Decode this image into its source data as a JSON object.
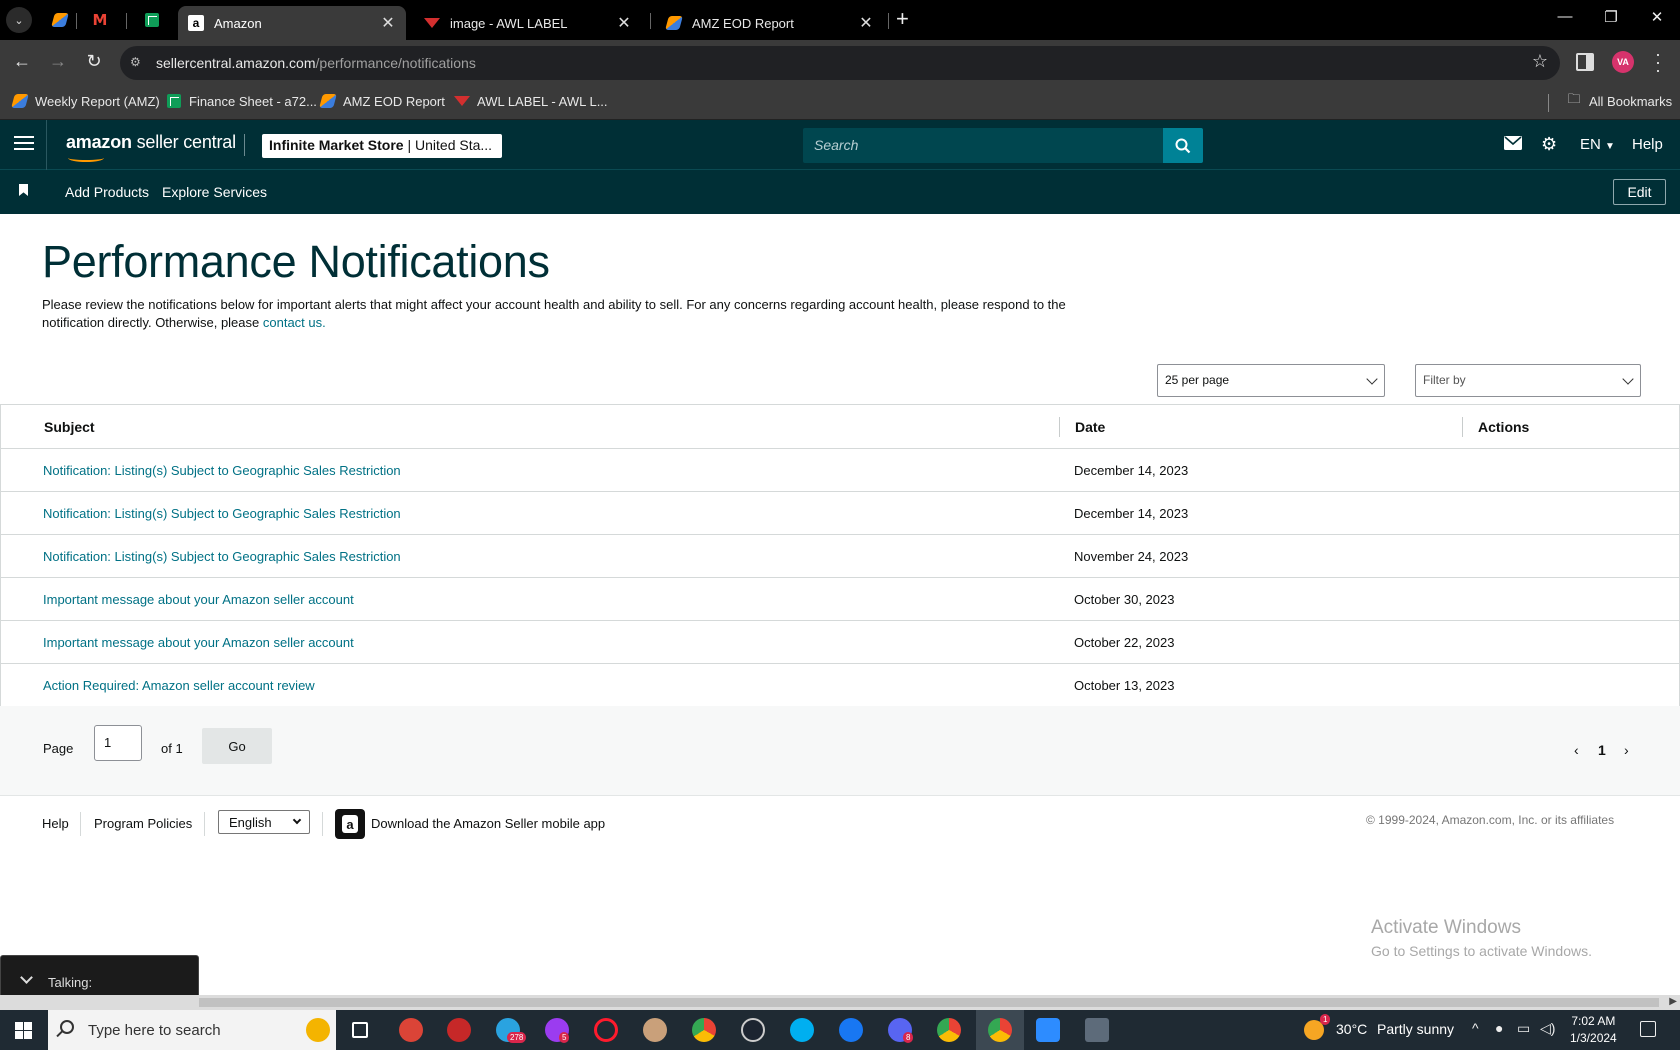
{
  "browser": {
    "tabs": [
      {
        "title": "Amazon",
        "active": true
      },
      {
        "title": "image - AWL LABEL",
        "active": false
      },
      {
        "title": "AMZ EOD Report",
        "active": false
      }
    ],
    "url_domain": "sellercentral.amazon.com",
    "url_path": "/performance/notifications",
    "profile_initials": "VA",
    "bookmarks": [
      {
        "label": "Weekly Report (AMZ)",
        "icon": "orange-app-icon"
      },
      {
        "label": "Finance Sheet - a72...",
        "icon": "sheets-icon"
      },
      {
        "label": "AMZ EOD Report",
        "icon": "orange-app-icon"
      },
      {
        "label": "AWL LABEL - AWL L...",
        "icon": "awl-icon"
      }
    ],
    "all_bookmarks_label": "All Bookmarks"
  },
  "header": {
    "logo_bold": "amazon",
    "logo_rest": " seller central",
    "store_name": "Infinite Market Store",
    "store_region": " | United Sta...",
    "search_placeholder": "Search",
    "language": "EN",
    "help": "Help"
  },
  "subnav": {
    "links": [
      "Add Products",
      "Explore Services"
    ],
    "edit": "Edit"
  },
  "main": {
    "title": "Performance Notifications",
    "intro_text": "Please review the notifications below for important alerts that might affect your account health and ability to sell. For any concerns regarding account health, please respond to the notification directly. Otherwise, please ",
    "intro_link": "contact us.",
    "per_page": "25 per page",
    "filter_placeholder": "Filter by",
    "columns": {
      "subject": "Subject",
      "date": "Date",
      "actions": "Actions"
    },
    "rows": [
      {
        "subject": "Notification: Listing(s) Subject to Geographic Sales Restriction",
        "date": "December 14, 2023"
      },
      {
        "subject": "Notification: Listing(s) Subject to Geographic Sales Restriction",
        "date": "December 14, 2023"
      },
      {
        "subject": "Notification: Listing(s) Subject to Geographic Sales Restriction",
        "date": "November 24, 2023"
      },
      {
        "subject": "Important message about your Amazon seller account",
        "date": "October 30, 2023"
      },
      {
        "subject": "Important message about your Amazon seller account",
        "date": "October 22, 2023"
      },
      {
        "subject": "Action Required: Amazon seller account review",
        "date": "October 13, 2023"
      }
    ],
    "pager": {
      "page_label": "Page",
      "page_value": "1",
      "of_label": "of 1",
      "go_label": "Go",
      "current": "1"
    }
  },
  "footer": {
    "help": "Help",
    "program_policies": "Program Policies",
    "language": "English",
    "download_app": "Download the Amazon Seller mobile app",
    "copyright": "© 1999-2024, Amazon.com, Inc. or its affiliates"
  },
  "overlay": {
    "watermark_title": "Activate Windows",
    "watermark_sub": "Go to Settings to activate Windows.",
    "talking_label": "Talking:"
  },
  "taskbar": {
    "search_placeholder": "Type here to search",
    "telegram_badge": "278",
    "messenger_badge": "5",
    "messenger2_badge": "8",
    "weather_temp": "30°C",
    "weather_desc": "Partly sunny",
    "weather_badge": "1",
    "time": "7:02 AM",
    "date": "1/3/2024"
  },
  "colors": {
    "header_bg": "#002f36",
    "link": "#007185",
    "search_btn": "#008296",
    "accent_orange": "#ff9900"
  }
}
